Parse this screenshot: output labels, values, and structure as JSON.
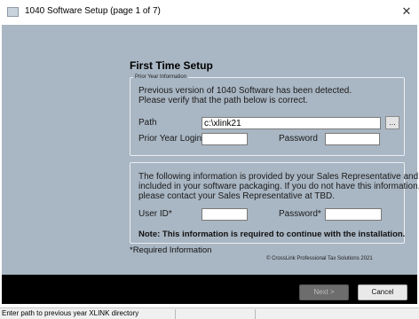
{
  "window": {
    "title": "1040 Software Setup (page 1 of 7)",
    "close_glyph": "✕"
  },
  "heading": "First Time Setup",
  "prior_year": {
    "legend": "Prior Year Information",
    "message_line1": "Previous version of 1040 Software has been detected.",
    "message_line2": "Please verify that the path below is correct.",
    "path_label": "Path",
    "path_value": "c:\\xlink21",
    "browse_label": "...",
    "login_label": "Prior Year Login",
    "login_value": "",
    "password_label": "Password",
    "password_value": ""
  },
  "sales_info": {
    "line1": "The following information is provided by your Sales Representative and is",
    "line2": "included in your software packaging. If you do not have this information,",
    "line3": "please contact your Sales Representative at TBD.",
    "user_id_label": "User ID*",
    "user_id_value": "",
    "password_label": "Password*",
    "password_value": "",
    "note": "Note: This information is required to continue with the installation."
  },
  "required_text": "*Required Information",
  "copyright": "© CrossLink Professional Tax Solutions 2021",
  "buttons": {
    "next": "Next >",
    "cancel": "Cancel"
  },
  "status": {
    "text": "Enter path to previous year XLINK directory"
  },
  "colors": {
    "body_bg": "#a9b6c3",
    "footer_bg": "#000000",
    "status_bg": "#f0f0f0"
  },
  "icons": {
    "app": "app-window-icon",
    "close": "close-icon"
  }
}
